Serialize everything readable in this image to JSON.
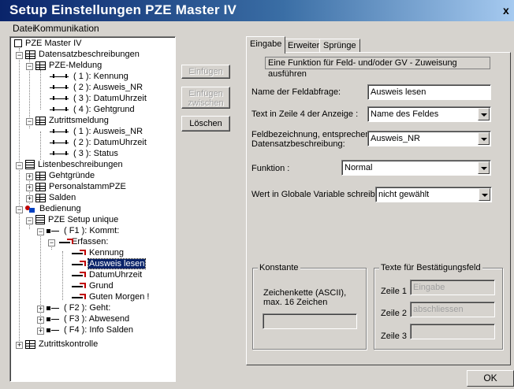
{
  "window": {
    "title": "Setup Einstellungen PZE Master IV",
    "close_label": "x"
  },
  "menu": [
    "Datei",
    "Kommunikation"
  ],
  "tree": {
    "root": "PZE Master IV",
    "datensatz": "Datensatzbeschreibungen",
    "pze_meldung": "PZE-Meldung",
    "pze_fields": [
      "( 1 ): Kennung",
      "( 2 ): Ausweis_NR",
      "( 3 ): DatumUhrzeit",
      "( 4 ): Gehtgrund"
    ],
    "zutritt": "Zutrittsmeldung",
    "zutritt_fields": [
      "( 1 ): Ausweis_NR",
      "( 2 ): DatumUhrzeit",
      "( 3 ): Status"
    ],
    "listen": "Listenbeschreibungen",
    "listen_items": [
      "Gehtgründe",
      "PersonalstammPZE",
      "Salden"
    ],
    "bedienung": "Bedienung",
    "setup": "PZE Setup unique",
    "f1": "( F1 ): Kommt:",
    "erfassen": "Erfassen:",
    "erfassen_items": [
      "Kennung",
      "Ausweis lesen",
      "DatumUhrzeit",
      "Grund",
      "Guten Morgen !"
    ],
    "f_items": [
      "( F2 ): Geht:",
      "( F3 ): Abwesend",
      "( F4 ): Info Salden"
    ],
    "zutrittskontrolle": "Zutrittskontrolle"
  },
  "buttons": {
    "einfuegen": "Einfügen",
    "einfuegen_zwischen_1": "Einfügen",
    "einfuegen_zwischen_2": "zwischen",
    "loeschen": "Löschen",
    "ok": "OK"
  },
  "tabs": [
    "Eingabe",
    "Erweitert",
    "Sprünge"
  ],
  "form": {
    "header": "Eine Funktion für Feld- und/oder GV - Zuweisung ausführen",
    "name_label": "Name der Feldabfrage:",
    "name_value": "Ausweis lesen",
    "text_label": "Text in Zeile 4 der Anzeige :",
    "text_value": "Name des Feldes",
    "feld_label_1": "Feldbezeichnung, entsprechend",
    "feld_label_2": "Datensatzbeschreibung:",
    "feld_value": "Ausweis_NR",
    "funktion_label": "Funktion :",
    "funktion_value": "Normal",
    "wert_label": "Wert in Globale Variable schreiben :",
    "wert_value": "nicht gewählt"
  },
  "konstante": {
    "title": "Konstante",
    "desc_1": "Zeichenkette (ASCII),",
    "desc_2": "max. 16 Zeichen",
    "value": ""
  },
  "bestaetigung": {
    "title": "Texte für Bestätigungsfeld",
    "zeile1_label": "Zeile 1",
    "zeile1_value": "Eingabe",
    "zeile2_label": "Zeile 2",
    "zeile2_value": "abschliessen",
    "zeile3_label": "Zeile 3",
    "zeile3_value": ""
  }
}
